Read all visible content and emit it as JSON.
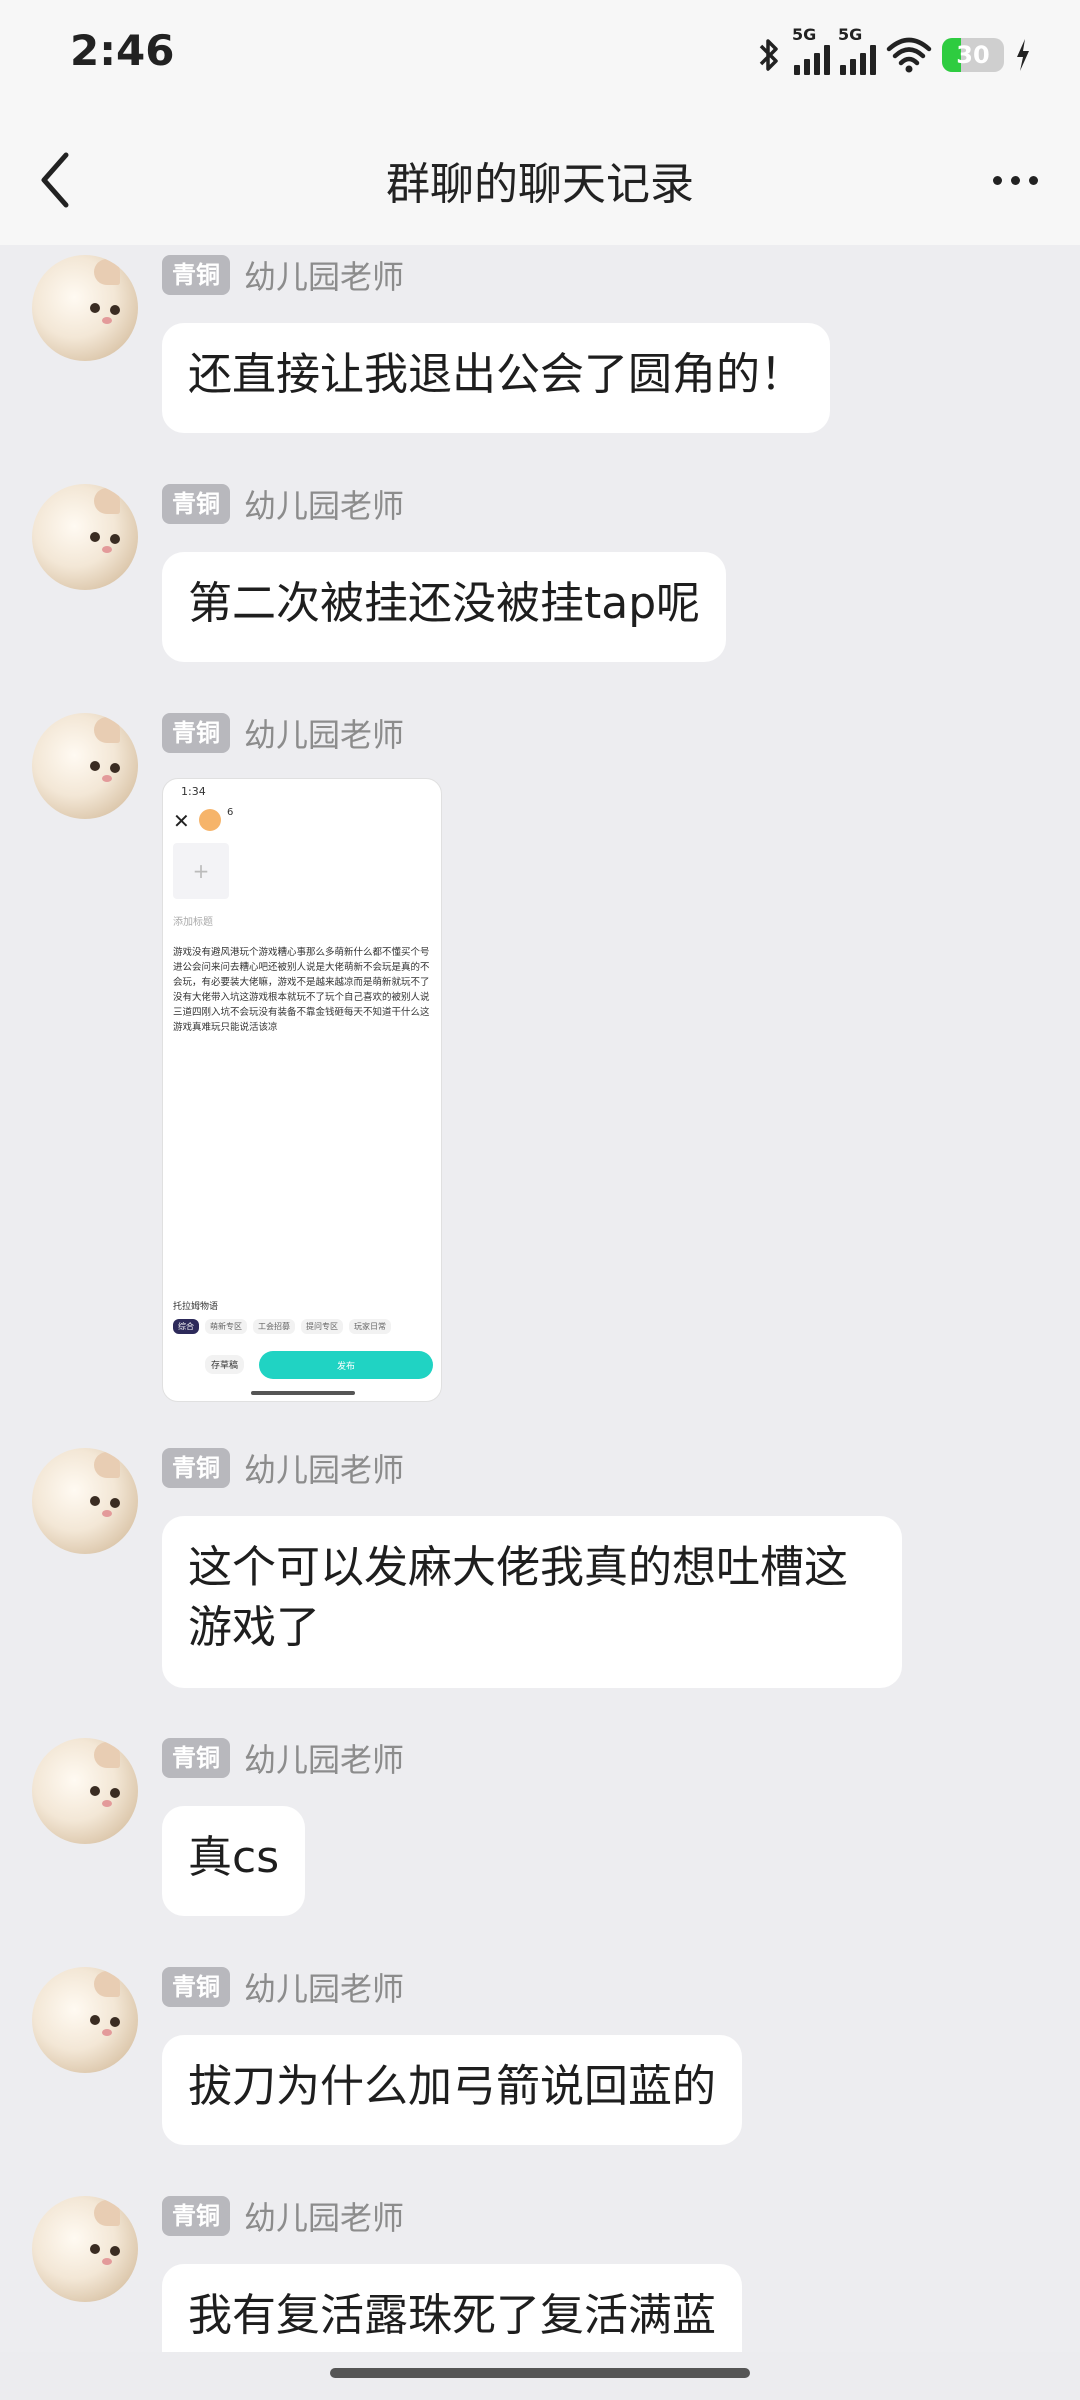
{
  "status_bar": {
    "time": "2:46",
    "battery": "30",
    "signal_1": "5G",
    "signal_2": "5G"
  },
  "header": {
    "title": "群聊的聊天记录"
  },
  "messages": [
    {
      "badge": "青铜",
      "sender": "幼儿园老师",
      "text": "还直接让我退出公会了圆角的！"
    },
    {
      "badge": "青铜",
      "sender": "幼儿园老师",
      "text": "第二次被挂还没被挂tap呢"
    },
    {
      "badge": "青铜",
      "sender": "幼儿园老师",
      "image": {
        "time": "1:34",
        "num": "6",
        "title_placeholder": "添加标题",
        "body": "游戏没有避风港玩个游戏糟心事那么多萌新什么都不懂买个号进公会问来问去糟心吧还被别人说是大佬萌新不会玩是真的不会玩，有必要装大佬嘛，游戏不是越来越凉而是萌新就玩不了没有大佬带入坑这游戏根本就玩不了玩个自己喜欢的被别人说三道四刚入坑不会玩没有装备不靠金钱砸每天不知道干什么这游戏真难玩只能说活该凉",
        "tag": "托拉姆物语",
        "categories": [
          "综合",
          "萌新专区",
          "工会招募",
          "提问专区",
          "玩家日常"
        ],
        "draft": "存草稿",
        "publish": "发布"
      }
    },
    {
      "badge": "青铜",
      "sender": "幼儿园老师",
      "text": "这个可以发麻大佬我真的想吐槽这游戏了"
    },
    {
      "badge": "青铜",
      "sender": "幼儿园老师",
      "text": "真cs"
    },
    {
      "badge": "青铜",
      "sender": "幼儿园老师",
      "text": "拔刀为什么加弓箭说回蓝的"
    },
    {
      "badge": "青铜",
      "sender": "幼儿园老师",
      "text": "我有复活露珠死了复活满蓝"
    }
  ]
}
